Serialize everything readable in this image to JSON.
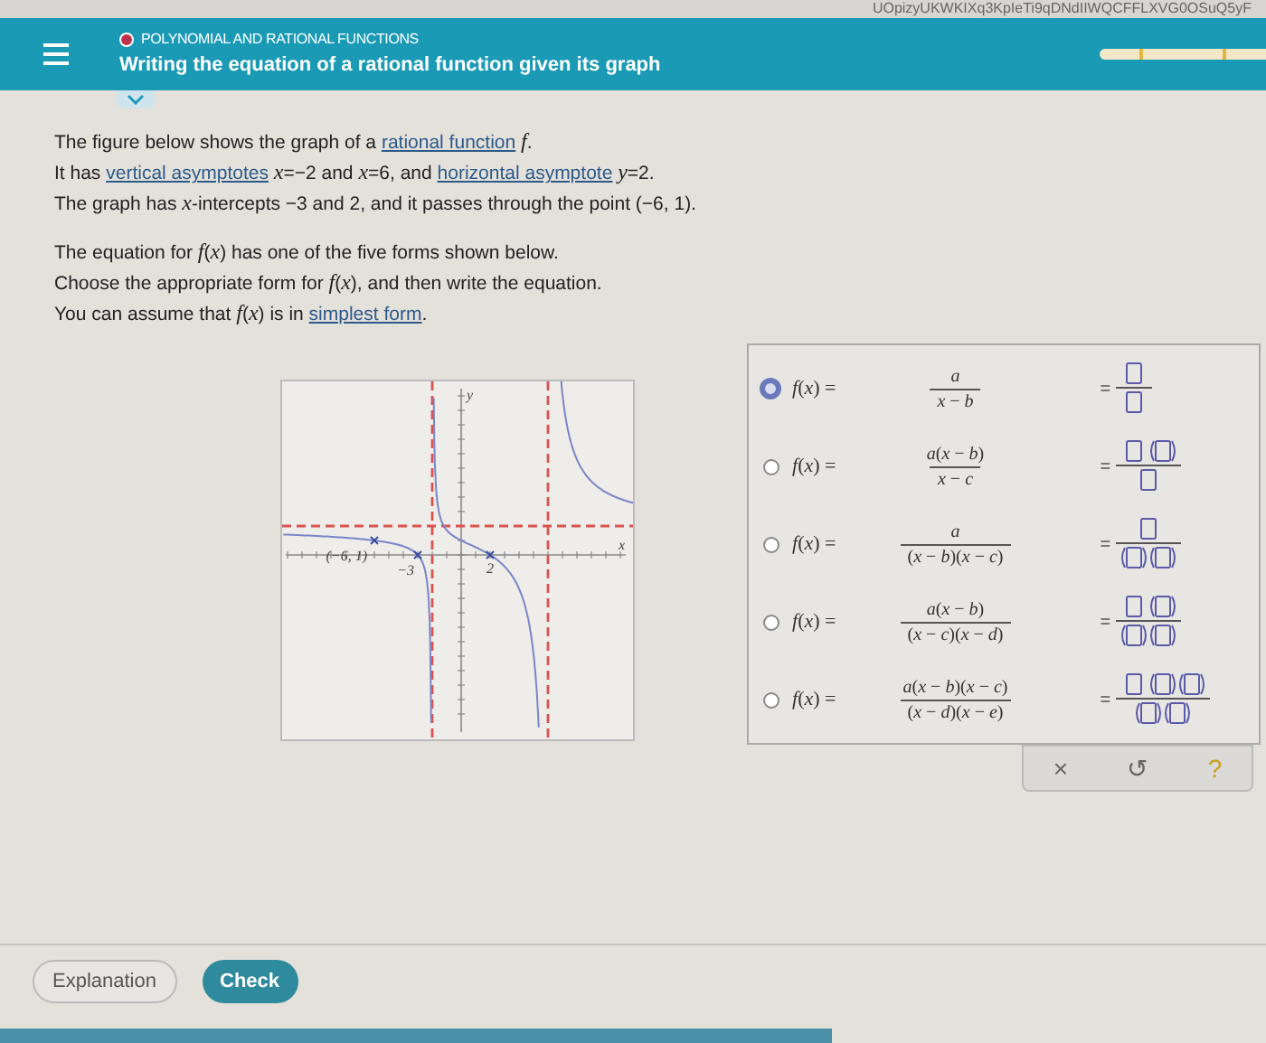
{
  "browser": {
    "url_fragment": "UOpizyUKWKIXq3KpIeTi9qDNdIIWQCFFLXVG0OSuQ5yF"
  },
  "header": {
    "topic": "POLYNOMIAL AND RATIONAL FUNCTIONS",
    "title": "Writing the equation of a rational function given its graph"
  },
  "intro": [
    [
      {
        "kind": "text",
        "text": "The figure below shows the graph of a "
      },
      {
        "kind": "link",
        "text": "rational function"
      },
      {
        "kind": "text",
        "text": " *f*."
      }
    ],
    [
      {
        "kind": "text",
        "text": "It has "
      },
      {
        "kind": "link",
        "text": "vertical asymptotes"
      },
      {
        "kind": "text",
        "text": " *x*=−2 and *x*=6, and "
      },
      {
        "kind": "link",
        "text": "horizontal asymptote"
      },
      {
        "kind": "text",
        "text": " *y*=2."
      }
    ],
    [
      {
        "kind": "text",
        "text": "The graph has *x*-intercepts −3 and 2, and it passes through the point (−6, 1)."
      }
    ]
  ],
  "instructions": [
    [
      {
        "kind": "text",
        "text": "The equation for *f*(*x*) has one of the five forms shown below."
      }
    ],
    [
      {
        "kind": "text",
        "text": "Choose the appropriate form for *f*(*x*), and then write the equation."
      }
    ],
    [
      {
        "kind": "text",
        "text": "You can assume that *f*(*x*) is in "
      },
      {
        "kind": "link",
        "text": "simplest form"
      },
      {
        "kind": "text",
        "text": "."
      }
    ]
  ],
  "graph": {
    "x_axis_label": "x",
    "y_axis_label": "y",
    "point_label": "(−6, 1)",
    "intercept_labels": [
      "−3",
      "2"
    ]
  },
  "forms": [
    {
      "selected": true,
      "lhs": "*f*(*x*) =",
      "numerator": "*a*",
      "denominator": "*x* − *b*",
      "equals": "=",
      "template": {
        "numerator": [
          {
            "kind": "box"
          }
        ],
        "denominator": [
          {
            "kind": "box"
          }
        ]
      }
    },
    {
      "selected": false,
      "lhs": "*f*(*x*) =",
      "numerator": "*a*(*x* − *b*)",
      "denominator": "*x* − *c*",
      "equals": "=",
      "template": {
        "numerator": [
          {
            "kind": "box"
          },
          {
            "kind": "paren"
          }
        ],
        "denominator": [
          {
            "kind": "box"
          }
        ]
      }
    },
    {
      "selected": false,
      "lhs": "*f*(*x*) =",
      "numerator": "*a*",
      "denominator": "(*x* − *b*)(*x* − *c*)",
      "equals": "=",
      "template": {
        "numerator": [
          {
            "kind": "box"
          }
        ],
        "denominator": [
          {
            "kind": "paren"
          },
          {
            "kind": "paren"
          }
        ]
      }
    },
    {
      "selected": false,
      "lhs": "*f*(*x*) =",
      "numerator": "*a*(*x* − *b*)",
      "denominator": "(*x* − *c*)(*x* − *d*)",
      "equals": "=",
      "template": {
        "numerator": [
          {
            "kind": "box"
          },
          {
            "kind": "paren"
          }
        ],
        "denominator": [
          {
            "kind": "paren"
          },
          {
            "kind": "paren"
          }
        ]
      }
    },
    {
      "selected": false,
      "lhs": "*f*(*x*) =",
      "numerator": "*a*(*x* − *b*)(*x* − *c*)",
      "denominator": "(*x* − *d*)(*x* − *e*)",
      "equals": "=",
      "template": {
        "numerator": [
          {
            "kind": "box"
          },
          {
            "kind": "paren"
          },
          {
            "kind": "paren"
          }
        ],
        "denominator": [
          {
            "kind": "paren"
          },
          {
            "kind": "paren"
          }
        ]
      }
    }
  ],
  "tools": {
    "clear": "×",
    "undo": "↺",
    "help": "?"
  },
  "footer": {
    "buttons": [
      {
        "kind": "secondary",
        "label": "Explanation"
      },
      {
        "kind": "primary",
        "label": "Check"
      }
    ]
  }
}
